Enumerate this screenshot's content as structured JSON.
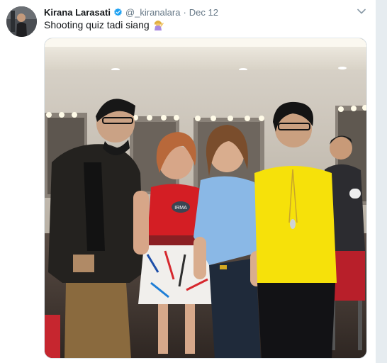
{
  "tweet": {
    "author_name": "Kirana Larasati",
    "handle": "@_kiranalara",
    "separator": "·",
    "time": "Dec 12",
    "text": "Shooting quiz tadi siang",
    "verified": true,
    "emoji": "woman-gesturing-emoji"
  },
  "media": {
    "alt_icon": "photo",
    "badge_1": "IRMA"
  },
  "colors": {
    "accent": "#1da1f2",
    "text": "#14171a",
    "muted": "#657786"
  }
}
